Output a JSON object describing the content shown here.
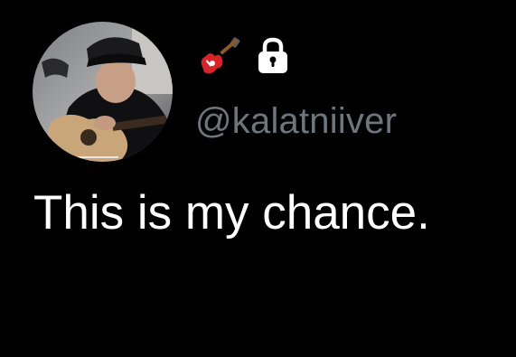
{
  "profile": {
    "handle": "@kalatniiver",
    "avatar_alt": "profile photo of a person in a black cap playing an acoustic guitar",
    "badges": [
      {
        "icon": "electric-guitar-icon",
        "color": "#d8232a"
      },
      {
        "icon": "lock-icon",
        "color": "#ffffff"
      }
    ]
  },
  "tweet": {
    "text": "This is my chance."
  },
  "colors": {
    "background": "#000000",
    "text": "#ffffff",
    "handle": "#6e767d"
  }
}
